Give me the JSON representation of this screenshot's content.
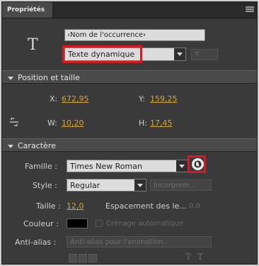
{
  "tab": {
    "label": "Propriétés"
  },
  "instance": {
    "name_placeholder": "‹Nom de l'occurrence›",
    "text_type": "Texte dynamique",
    "extra_dropdown": "T"
  },
  "position": {
    "header": "Position et taille",
    "x_label": "X:",
    "x_value": "672,95",
    "y_label": "Y:",
    "y_value": "159,25",
    "w_label": "W:",
    "w_value": "10,20",
    "h_label": "H:",
    "h_value": "17,45"
  },
  "character": {
    "header": "Caractère",
    "family_label": "Famille :",
    "family_value": "Times New Roman",
    "style_label": "Style :",
    "style_value": "Regular",
    "embed_label": "Incorporer...",
    "size_label": "Taille :",
    "size_value": "12,0",
    "spacing_label": "Espacement des le...",
    "spacing_value": "0,0",
    "color_label": "Couleur :",
    "autokern_label": "Crénage automatique",
    "antialias_label": "Anti-alias :",
    "antialias_value": "Anti-alias pour l'animation"
  },
  "colors": {
    "highlight": "#d81920",
    "accent_value": "#d1a53a"
  }
}
